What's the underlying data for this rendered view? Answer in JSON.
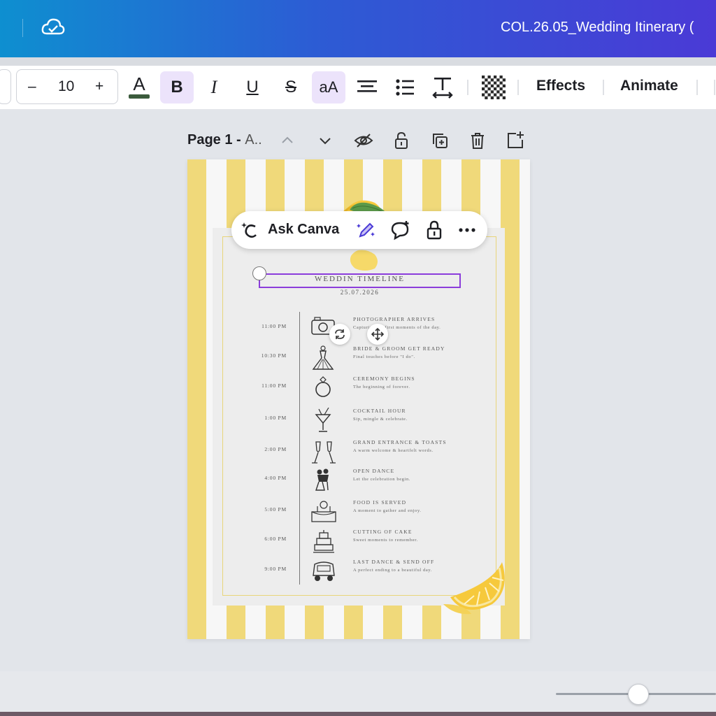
{
  "header": {
    "title": "COL.26.05_Wedding Itinerary ("
  },
  "toolbar": {
    "font_size": "10",
    "minus": "–",
    "plus": "+",
    "text_color_glyph": "A",
    "bold": "B",
    "italic": "I",
    "underline": "U",
    "strikethrough": "S",
    "case": "aA",
    "effects": "Effects",
    "animate": "Animate",
    "text_color_hex": "#3b5b3c"
  },
  "page_bar": {
    "label": "Page 1 - ",
    "name": "A.."
  },
  "ask_canva": {
    "label": "Ask Canva"
  },
  "design": {
    "heading": "WEDDIN TIMELINE",
    "date": "25.07.2026",
    "accent_color": "#8b3ddb",
    "stripe_color": "#f0d97a",
    "items": [
      {
        "time": "11:00 PM",
        "event": "PHOTOGRAPHER ARRIVES",
        "desc": "Capturing the first moments of the day.",
        "icon": "camera-icon"
      },
      {
        "time": "10:30 PM",
        "event": "BRIDE & GROOM GET READY",
        "desc": "Final touches before \"I do\".",
        "icon": "dress-icon"
      },
      {
        "time": "11:00 PM",
        "event": "CEREMONY BEGINS",
        "desc": "The beginning of forever.",
        "icon": "ring-icon"
      },
      {
        "time": "1:00 PM",
        "event": "COCKTAIL HOUR",
        "desc": "Sip, mingle & celebrate.",
        "icon": "cocktail-icon"
      },
      {
        "time": "2:00 PM",
        "event": "GRAND ENTRANCE & TOASTS",
        "desc": "A warm welcome & heartfelt words.",
        "icon": "champagne-icon"
      },
      {
        "time": "4:00 PM",
        "event": "OPEN DANCE",
        "desc": "Let the celebration begin.",
        "icon": "dancing-couple-icon"
      },
      {
        "time": "5:00 PM",
        "event": "FOOD IS SERVED",
        "desc": "A moment to gather and enjoy.",
        "icon": "dining-table-icon"
      },
      {
        "time": "6:00 PM",
        "event": "CUTTING OF CAKE",
        "desc": "Sweet moments to remember.",
        "icon": "cake-icon"
      },
      {
        "time": "9:00 PM",
        "event": "LAST DANCE & SEND OFF",
        "desc": "A perfect ending to a beautiful day.",
        "icon": "car-icon"
      }
    ]
  }
}
